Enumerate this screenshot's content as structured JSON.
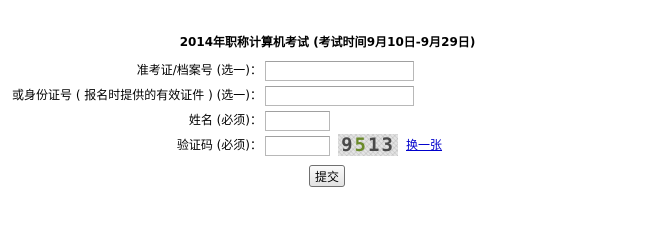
{
  "form": {
    "title": "2014年职称计算机考试 (考试时间9月10日-9月29日)",
    "fields": [
      {
        "label": "准考证/档案号 (选一)：",
        "value": ""
      },
      {
        "label": "或身份证号 ( 报名时提供的有效证件 ) (选一)：",
        "value": ""
      },
      {
        "label": "姓名 (必须)：",
        "value": ""
      },
      {
        "label": "验证码 (必须)：",
        "value": ""
      }
    ],
    "captcha": {
      "d1": "9",
      "d2": "5",
      "d3": "1",
      "d4": "3"
    },
    "refresh_link": "换一张",
    "submit_label": "提交"
  }
}
